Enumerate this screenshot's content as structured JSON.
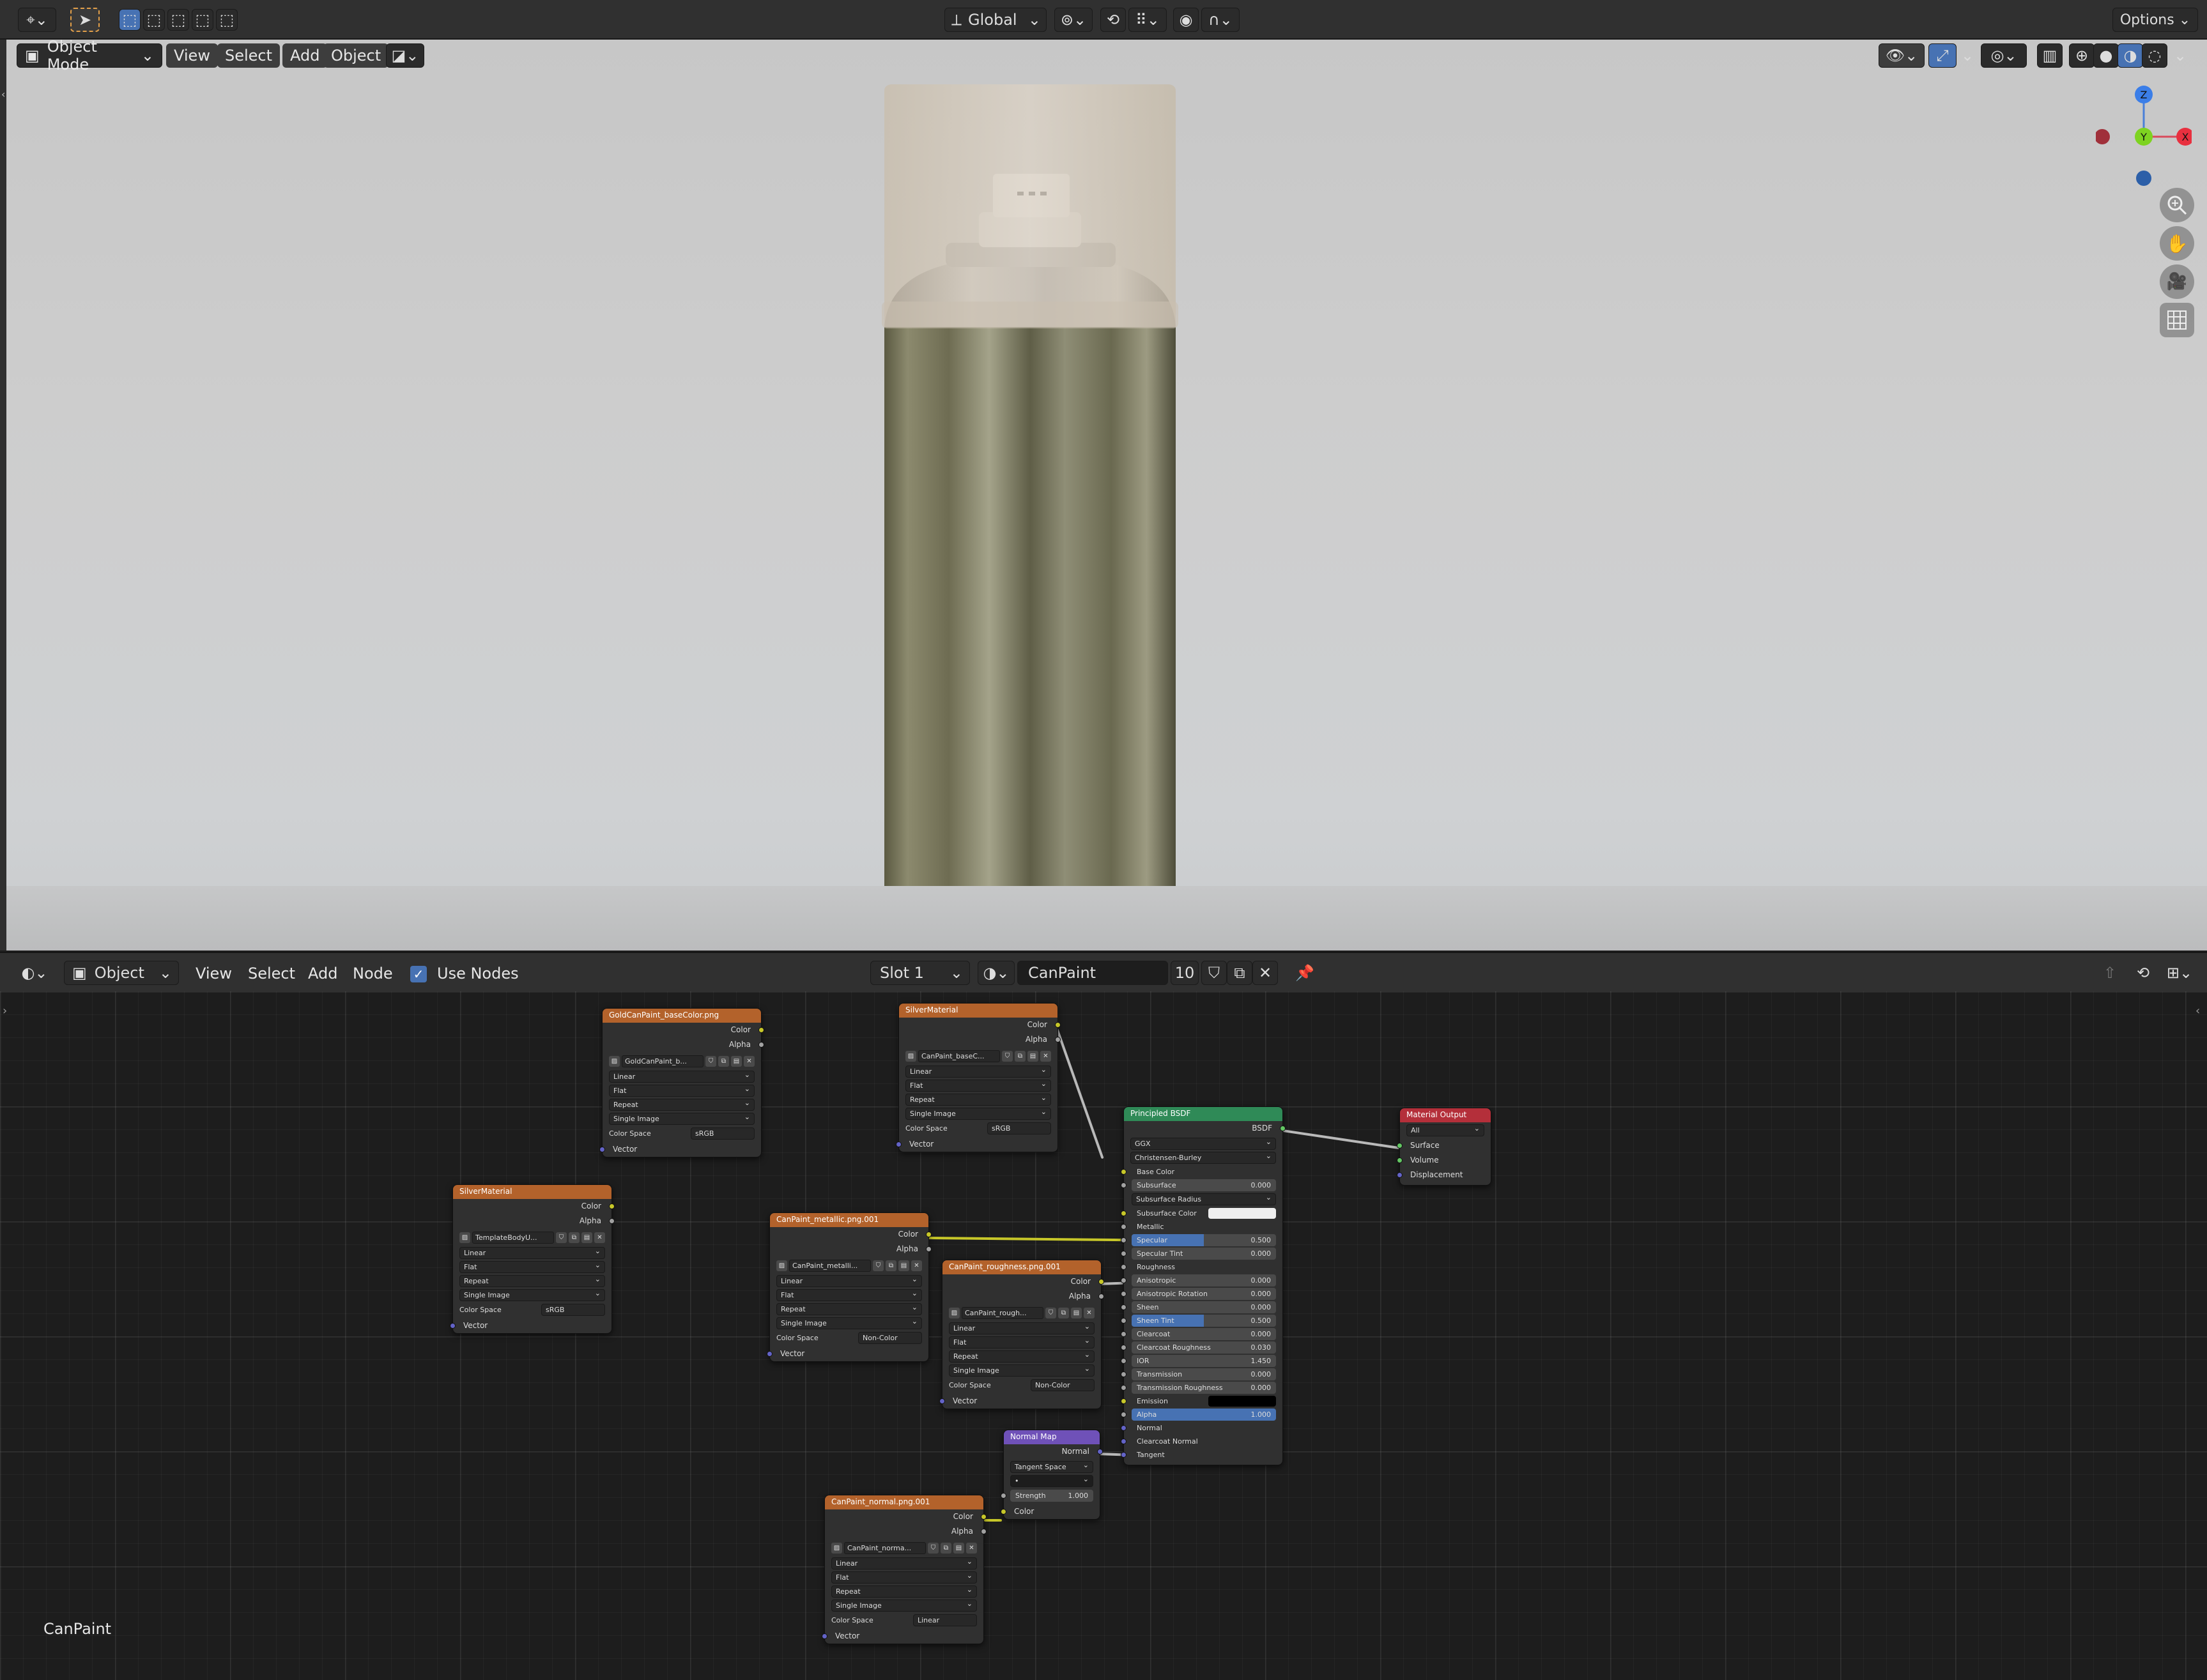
{
  "top_header": {
    "transform_orientation": "Global",
    "options_label": "Options"
  },
  "viewport_header": {
    "mode": "Object Mode",
    "menus": [
      "View",
      "Select",
      "Add",
      "Object"
    ]
  },
  "gizmo": {
    "z": "Z",
    "y": "Y",
    "x": "X"
  },
  "node_header": {
    "object_label": "Object",
    "menus": [
      "View",
      "Select",
      "Add",
      "Node"
    ],
    "use_nodes_label": "Use Nodes",
    "slot": "Slot 1",
    "material_name": "CanPaint",
    "user_count": "10"
  },
  "node_editor": {
    "tree_name": "CanPaint"
  },
  "image_node_common": {
    "interp": "Linear",
    "proj": "Flat",
    "ext": "Repeat",
    "source": "Single Image",
    "colorspace_label": "Color Space",
    "out_color": "Color",
    "out_alpha": "Alpha",
    "in_vector": "Vector"
  },
  "nodes": {
    "gold": {
      "title": "GoldCanPaint_baseColor.png",
      "image": "GoldCanPaint_b...",
      "colorspace": "sRGB"
    },
    "silver_top": {
      "title": "SilverMaterial",
      "image": "CanPaint_baseC...",
      "colorspace": "sRGB"
    },
    "silver_left": {
      "title": "SilverMaterial",
      "image": "TemplateBodyU...",
      "colorspace": "sRGB"
    },
    "metallic": {
      "title": "CanPaint_metallic.png.001",
      "image": "CanPaint_metalli...",
      "colorspace": "Non-Color"
    },
    "roughness": {
      "title": "CanPaint_roughness.png.001",
      "image": "CanPaint_rough...",
      "colorspace": "Non-Color"
    },
    "normal_tex": {
      "title": "CanPaint_normal.png.001",
      "image": "CanPaint_norma...",
      "colorspace": "Linear"
    },
    "normal_map": {
      "title": "Normal Map",
      "out_normal": "Normal",
      "space": "Tangent Space",
      "strength_label": "Strength",
      "strength": "1.000",
      "in_color": "Color"
    },
    "bsdf": {
      "title": "Principled BSDF",
      "out": "BSDF",
      "distribution": "GGX",
      "subsurface_method": "Christensen-Burley",
      "base_color": "Base Color",
      "subsurface": {
        "label": "Subsurface",
        "value": "0.000"
      },
      "subsurface_radius": "Subsurface Radius",
      "subsurface_color": "Subsurface Color",
      "metallic": "Metallic",
      "specular": {
        "label": "Specular",
        "value": "0.500"
      },
      "specular_tint": {
        "label": "Specular Tint",
        "value": "0.000"
      },
      "roughness": "Roughness",
      "anisotropic": {
        "label": "Anisotropic",
        "value": "0.000"
      },
      "anisotropic_rotation": {
        "label": "Anisotropic Rotation",
        "value": "0.000"
      },
      "sheen": {
        "label": "Sheen",
        "value": "0.000"
      },
      "sheen_tint": {
        "label": "Sheen Tint",
        "value": "0.500"
      },
      "clearcoat": {
        "label": "Clearcoat",
        "value": "0.000"
      },
      "clearcoat_roughness": {
        "label": "Clearcoat Roughness",
        "value": "0.030"
      },
      "ior": {
        "label": "IOR",
        "value": "1.450"
      },
      "transmission": {
        "label": "Transmission",
        "value": "0.000"
      },
      "transmission_roughness": {
        "label": "Transmission Roughness",
        "value": "0.000"
      },
      "emission": "Emission",
      "alpha": {
        "label": "Alpha",
        "value": "1.000"
      },
      "normal": "Normal",
      "clearcoat_normal": "Clearcoat Normal",
      "tangent": "Tangent"
    },
    "output": {
      "title": "Material Output",
      "target": "All",
      "surface": "Surface",
      "volume": "Volume",
      "displacement": "Displacement"
    }
  },
  "colors": {
    "accent": "#4772b3",
    "texture_header": "#b3622b",
    "shader_header": "#2f8a57",
    "output_header": "#b42f3a",
    "vector_header": "#6f51b8"
  }
}
